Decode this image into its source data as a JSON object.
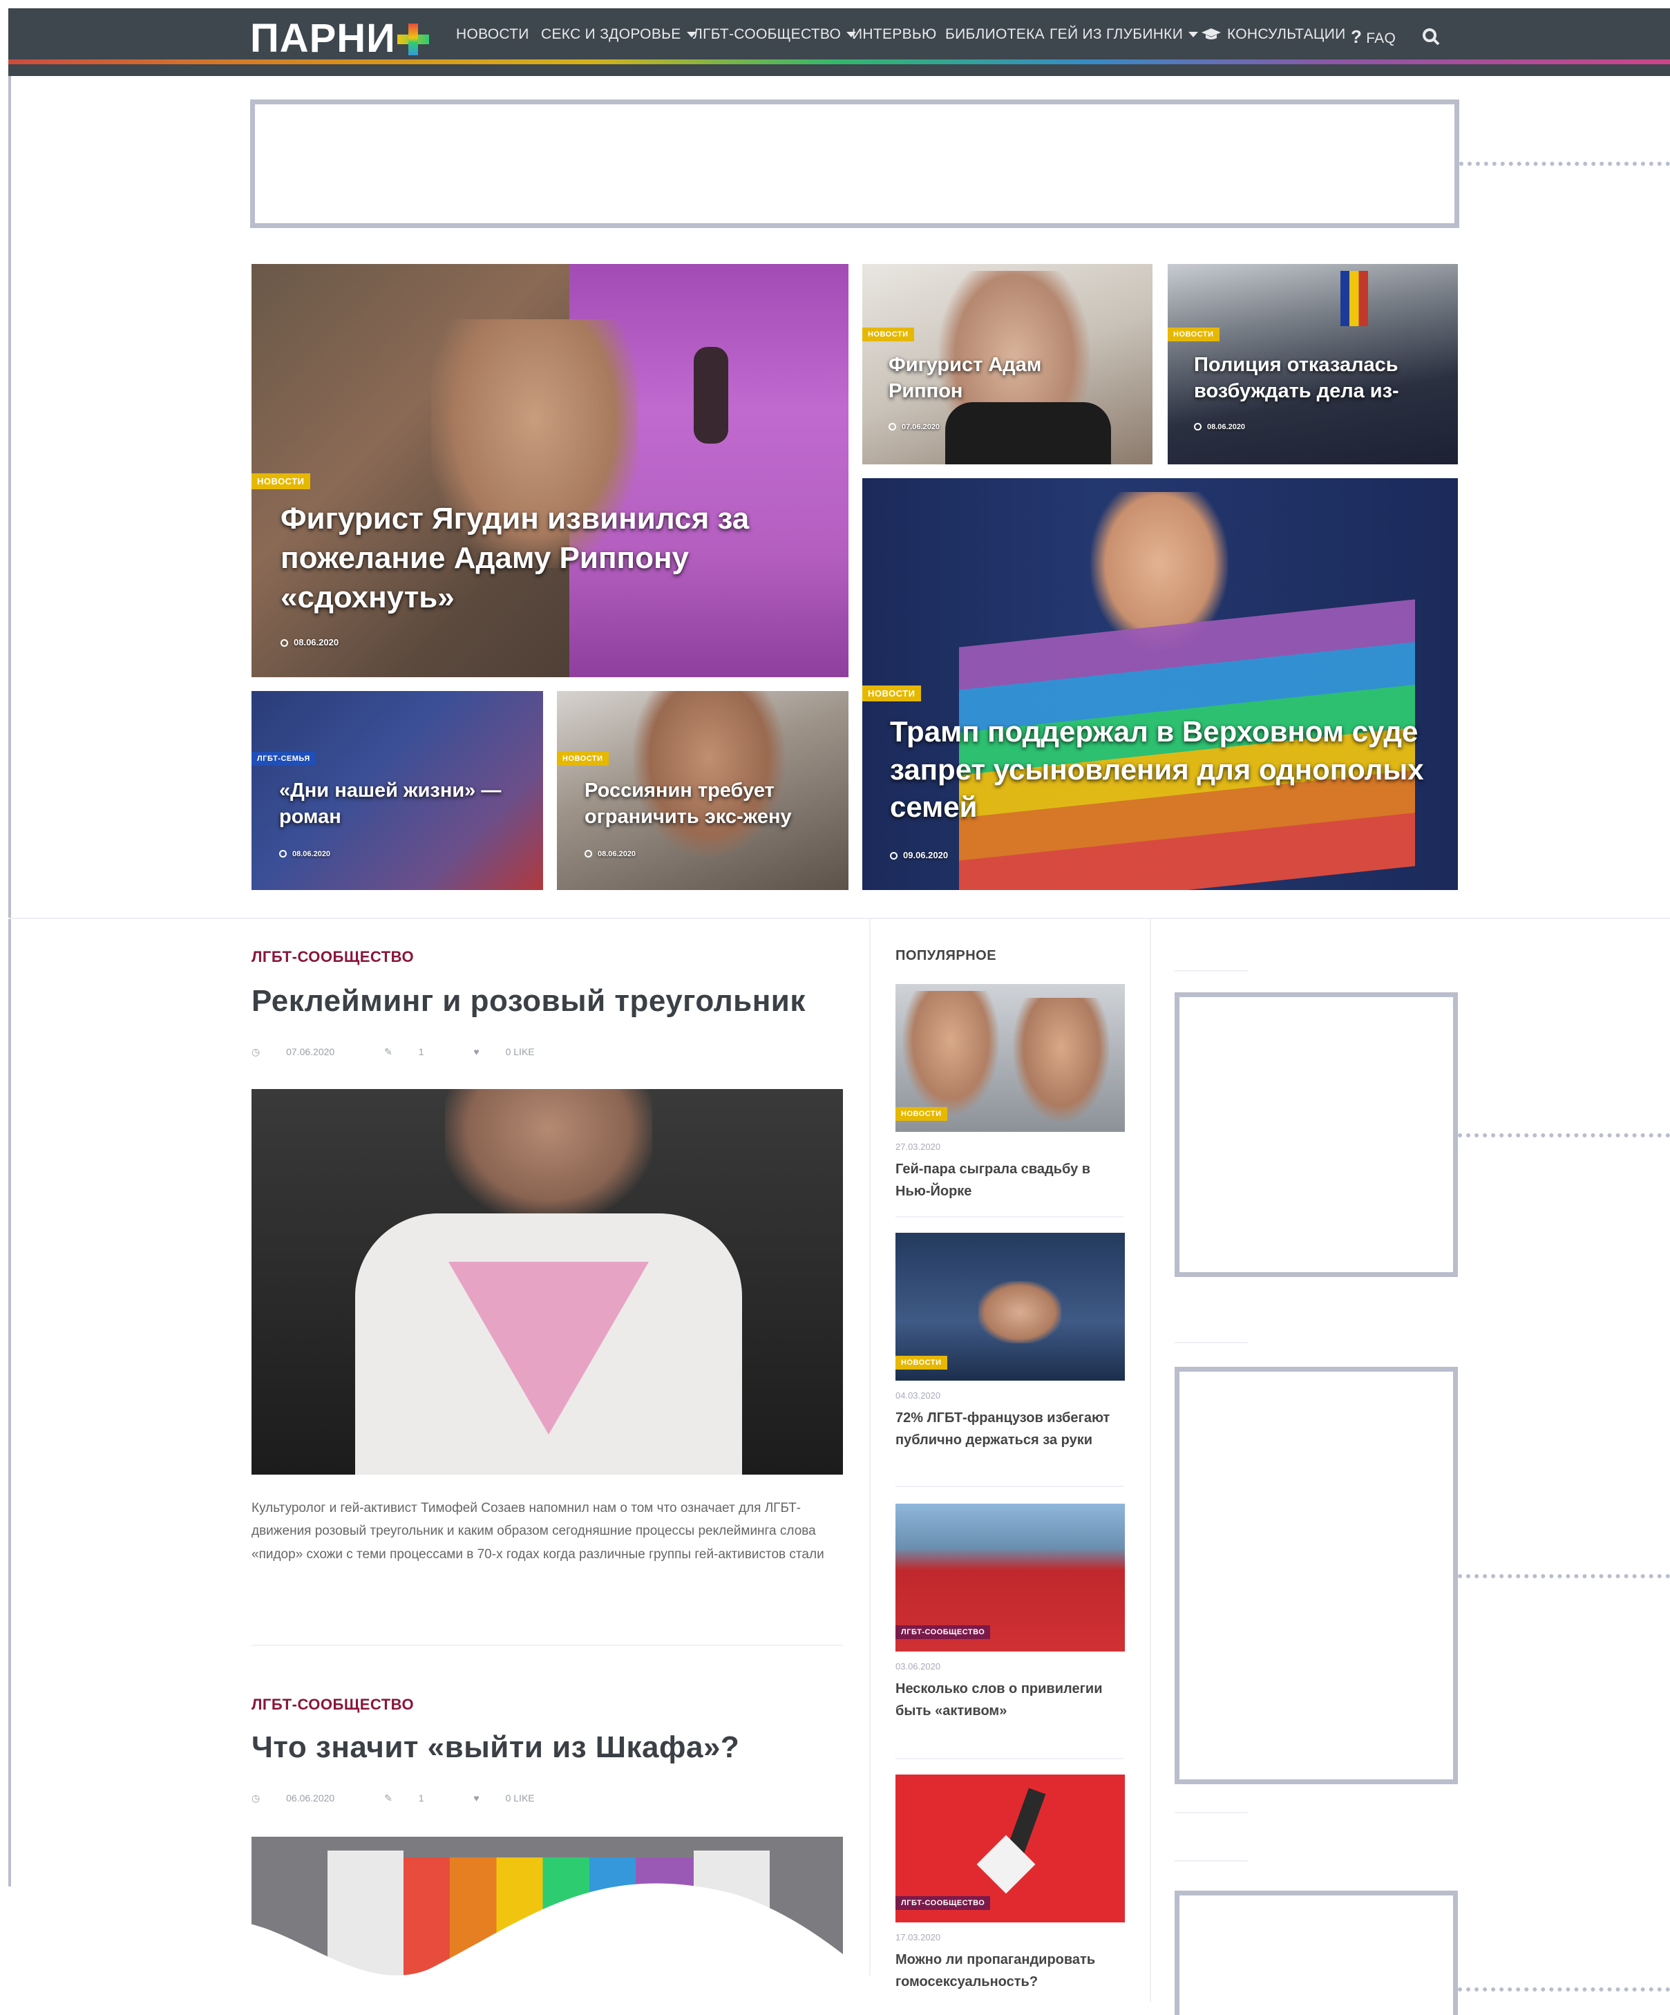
{
  "nav": {
    "logo": "ПАРНИ",
    "items": [
      {
        "label": "НОВОСТИ",
        "dropdown": false
      },
      {
        "label": "СЕКС И ЗДОРОВЬЕ",
        "dropdown": true
      },
      {
        "label": "ЛГБТ-СООБЩЕСТВО",
        "dropdown": true
      },
      {
        "label": "ИНТЕРВЬЮ",
        "dropdown": false
      },
      {
        "label": "БИБЛИОТЕКА",
        "dropdown": false
      },
      {
        "label": "ГЕЙ ИЗ ГЛУБИНКИ",
        "dropdown": true
      },
      {
        "label": "КОНСУЛЬТАЦИИ",
        "dropdown": false
      },
      {
        "label": "FAQ",
        "dropdown": false
      }
    ],
    "icons": [
      "graduation-cap-icon",
      "question-icon",
      "search-icon"
    ]
  },
  "featured": [
    {
      "badge": "НОВОСТИ",
      "title": "Фигурист Ягудин извинился за пожелание Адаму Риппону «сдохнуть»",
      "date": "08.06.2020"
    },
    {
      "badge": "НОВОСТИ",
      "title": "Фигурист Адам Риппон",
      "date": "07.06.2020"
    },
    {
      "badge": "НОВОСТИ",
      "title": "Полиция отказалась возбуждать дела из-",
      "date": "08.06.2020"
    },
    {
      "badge": "НОВОСТИ",
      "title": "Трамп поддержал в Верховном суде запрет усыновления для однополых семей",
      "date": "09.06.2020"
    },
    {
      "badge": "ЛГБТ-СЕМЬЯ",
      "title": "«Дни нашей жизни» — роман",
      "date": "08.06.2020"
    },
    {
      "badge": "НОВОСТИ",
      "title": "Россиянин требует ограничить экс-жену",
      "date": "08.06.2020"
    }
  ],
  "articles": [
    {
      "category": "ЛГБТ-СООБЩЕСТВО",
      "title": "Реклейминг и розовый треугольник",
      "date": "07.06.2020",
      "comments": "1",
      "likes": "0 LIKE",
      "excerpt": "Культуролог и гей-активист Тимофей Созаев напомнил нам о том что означает для ЛГБТ-движения розовый треугольник и каким образом сегодняшние процессы реклейминга слова «пидор» схожи с теми процессами в 70-х годах когда различные группы гей-активистов стали"
    },
    {
      "category": "ЛГБТ-СООБЩЕСТВО",
      "title": "Что значит «выйти из Шкафа»?",
      "date": "06.06.2020",
      "comments": "1",
      "likes": "0 LIKE"
    }
  ],
  "popular": {
    "heading": "ПОПУЛЯРНОЕ",
    "items": [
      {
        "badge": "НОВОСТИ",
        "date": "27.03.2020",
        "title": "Гей-пара сыграла свадьбу в Нью-Йорке"
      },
      {
        "badge": "НОВОСТИ",
        "date": "04.03.2020",
        "title": "72% ЛГБТ-французов избегают публично держаться за руки"
      },
      {
        "badge": "ЛГБТ-СООБЩЕСТВО",
        "date": "03.06.2020",
        "title": "Несколько слов о привилегии быть «активом»"
      },
      {
        "badge": "ЛГБТ-СООБЩЕСТВО",
        "date": "17.03.2020",
        "title": "Можно ли пропагандировать гомосексуальность?"
      }
    ]
  },
  "colors": {
    "nav_bg": "#3e464e",
    "frame": "#b9bdcc",
    "category": "#8a1538",
    "badge_yellow": "#e6b800",
    "badge_blue": "#1f4fb8"
  }
}
